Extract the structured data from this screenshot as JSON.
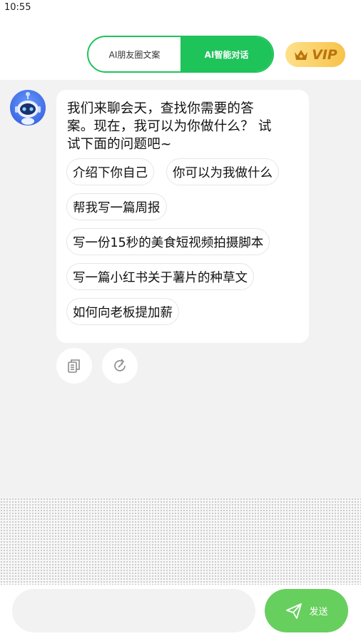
{
  "status_bar": {
    "time": "10:55"
  },
  "header": {
    "tabs": [
      {
        "label": "AI朋友圈文案",
        "active": false
      },
      {
        "label": "AI智能对话",
        "active": true
      }
    ],
    "vip_label": "VIP"
  },
  "colors": {
    "accent": "#1ec35a",
    "send": "#67cf5e",
    "vip": "#f7c34a"
  },
  "chat": {
    "message_lines": [
      "我们来聊会天，查找你需要的答",
      "案。现在，我可以为你做什么？ 试",
      "试下面的问题吧~"
    ],
    "suggestions": [
      "介绍下你自己",
      "你可以为我做什么",
      "帮我写一篇周报",
      "写一份15秒的美食短视频拍摄脚本",
      "写一篇小红书关于薯片的种草文",
      "如何向老板提加薪"
    ],
    "actions": [
      "copy-icon",
      "refresh-icon"
    ]
  },
  "composer": {
    "input_value": "",
    "send_label": "发送"
  }
}
